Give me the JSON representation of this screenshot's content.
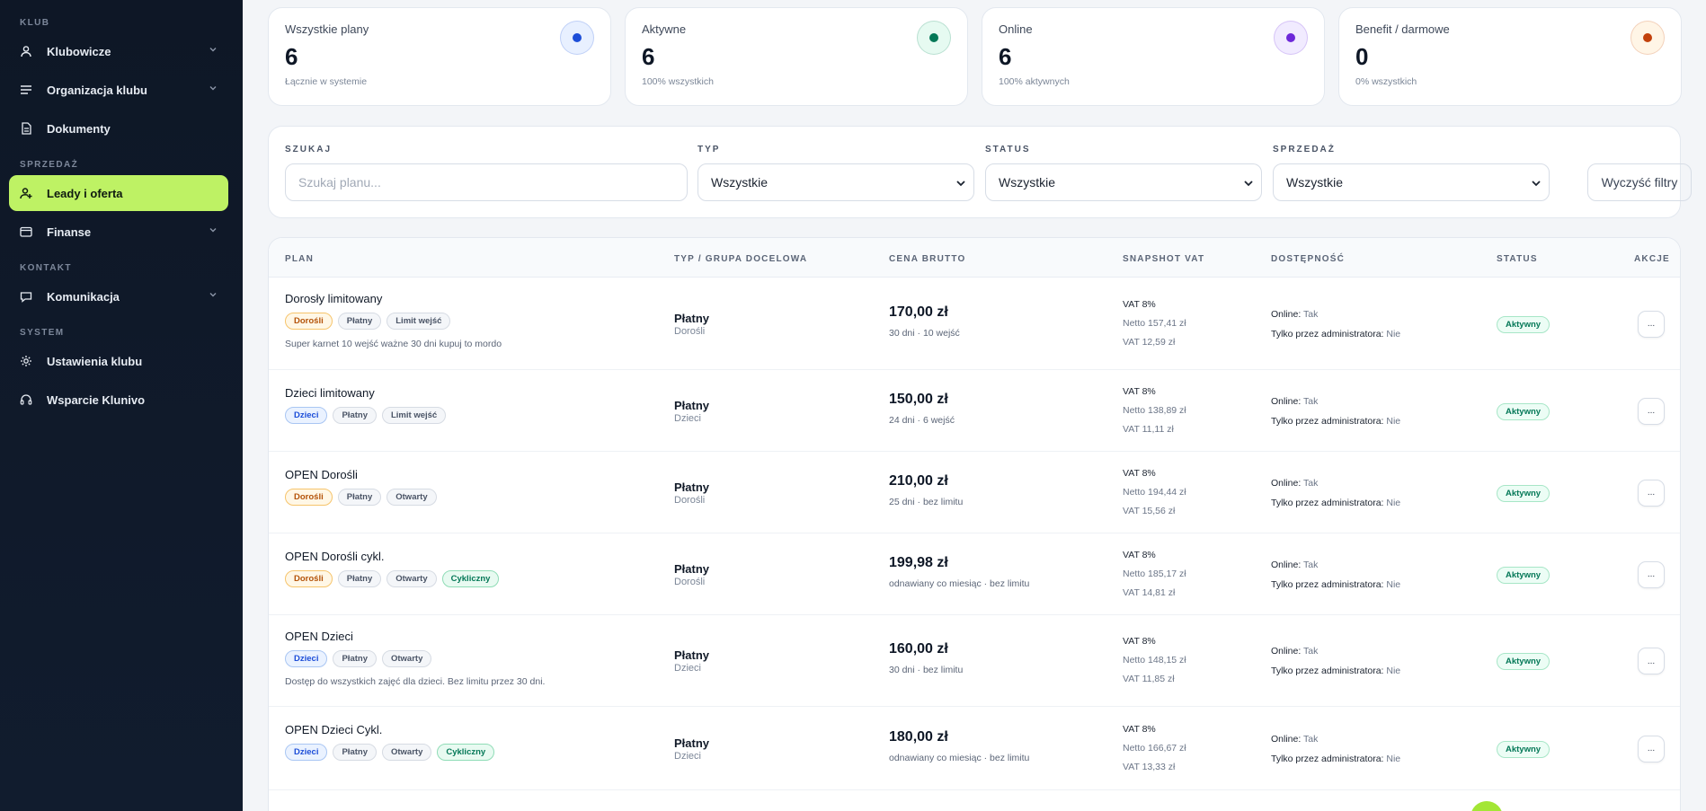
{
  "sidebar": {
    "sections": [
      {
        "label": "KLUB",
        "items": [
          {
            "label": "Klubowicze",
            "icon": "user-icon",
            "chevron": true
          },
          {
            "label": "Organizacja klubu",
            "icon": "list-icon",
            "chevron": true
          },
          {
            "label": "Dokumenty",
            "icon": "document-icon",
            "chevron": false
          }
        ]
      },
      {
        "label": "SPRZEDAŻ",
        "items": [
          {
            "label": "Leady i oferta",
            "icon": "user-plus-icon",
            "chevron": false,
            "active": true
          },
          {
            "label": "Finanse",
            "icon": "wallet-icon",
            "chevron": true
          }
        ]
      },
      {
        "label": "KONTAKT",
        "items": [
          {
            "label": "Komunikacja",
            "icon": "chat-icon",
            "chevron": true
          }
        ]
      },
      {
        "label": "SYSTEM",
        "items": [
          {
            "label": "Ustawienia klubu",
            "icon": "gear-icon",
            "chevron": false
          },
          {
            "label": "Wsparcie Klunivo",
            "icon": "headset-icon",
            "chevron": false
          }
        ]
      }
    ]
  },
  "stats": [
    {
      "title": "Wszystkie plany",
      "value": "6",
      "sub": "Łącznie w systemie",
      "color": "#1d4ed8",
      "ring": "#e8f0ff"
    },
    {
      "title": "Aktywne",
      "value": "6",
      "sub": "100% wszystkich",
      "color": "#047857",
      "ring": "#e6faf1"
    },
    {
      "title": "Online",
      "value": "6",
      "sub": "100% aktywnych",
      "color": "#6d28d9",
      "ring": "#f1ebff"
    },
    {
      "title": "Benefit / darmowe",
      "value": "0",
      "sub": "0% wszystkich",
      "color": "#c2410c",
      "ring": "#fff5e6"
    }
  ],
  "filters": {
    "search_label": "SZUKAJ",
    "search_placeholder": "Szukaj planu...",
    "type_label": "TYP",
    "type_value": "Wszystkie",
    "status_label": "STATUS",
    "status_value": "Wszystkie",
    "sale_label": "SPRZEDAŻ",
    "sale_value": "Wszystkie",
    "clear_label": "Wyczyść filtry"
  },
  "table": {
    "headers": [
      "PLAN",
      "TYP / GRUPA DOCELOWA",
      "CENA BRUTTO",
      "SNAPSHOT VAT",
      "DOSTĘPNOŚĆ",
      "STATUS",
      "AKCJE"
    ],
    "rows": [
      {
        "name": "Dorosły limitowany",
        "tags": [
          [
            "Dorośli",
            "adult"
          ],
          [
            "Płatny",
            ""
          ],
          [
            "Limit wejść",
            ""
          ]
        ],
        "desc": "Super karnet 10 wejść ważne 30 dni kupuj to mordo",
        "type": "Płatny",
        "group": "Dorośli",
        "price": "170,00 zł",
        "price_sub": "30 dni · 10 wejść",
        "vat": "VAT 8%",
        "netto": "Netto 157,41 zł",
        "vat_amt": "VAT 12,59 zł",
        "online_label": "Online:",
        "online_val": "Tak",
        "admin_label": "Tylko przez administratora:",
        "admin_val": "Nie",
        "status": "Aktywny",
        "action": "..."
      },
      {
        "name": "Dzieci limitowany",
        "tags": [
          [
            "Dzieci",
            "kids"
          ],
          [
            "Płatny",
            ""
          ],
          [
            "Limit wejść",
            ""
          ]
        ],
        "desc": "",
        "type": "Płatny",
        "group": "Dzieci",
        "price": "150,00 zł",
        "price_sub": "24 dni · 6 wejść",
        "vat": "VAT 8%",
        "netto": "Netto 138,89 zł",
        "vat_amt": "VAT 11,11 zł",
        "online_label": "Online:",
        "online_val": "Tak",
        "admin_label": "Tylko przez administratora:",
        "admin_val": "Nie",
        "status": "Aktywny",
        "action": "..."
      },
      {
        "name": "OPEN Dorośli",
        "tags": [
          [
            "Dorośli",
            "adult"
          ],
          [
            "Płatny",
            ""
          ],
          [
            "Otwarty",
            ""
          ]
        ],
        "desc": "",
        "type": "Płatny",
        "group": "Dorośli",
        "price": "210,00 zł",
        "price_sub": "25 dni · bez limitu",
        "vat": "VAT 8%",
        "netto": "Netto 194,44 zł",
        "vat_amt": "VAT 15,56 zł",
        "online_label": "Online:",
        "online_val": "Tak",
        "admin_label": "Tylko przez administratora:",
        "admin_val": "Nie",
        "status": "Aktywny",
        "action": "..."
      },
      {
        "name": "OPEN Dorośli cykl.",
        "tags": [
          [
            "Dorośli",
            "adult"
          ],
          [
            "Płatny",
            ""
          ],
          [
            "Otwarty",
            ""
          ],
          [
            "Cykliczny",
            "cyc"
          ]
        ],
        "desc": "",
        "type": "Płatny",
        "group": "Dorośli",
        "price": "199,98 zł",
        "price_sub": "odnawiany co miesiąc · bez limitu",
        "vat": "VAT 8%",
        "netto": "Netto 185,17 zł",
        "vat_amt": "VAT 14,81 zł",
        "online_label": "Online:",
        "online_val": "Tak",
        "admin_label": "Tylko przez administratora:",
        "admin_val": "Nie",
        "status": "Aktywny",
        "action": "..."
      },
      {
        "name": "OPEN Dzieci",
        "tags": [
          [
            "Dzieci",
            "kids"
          ],
          [
            "Płatny",
            ""
          ],
          [
            "Otwarty",
            ""
          ]
        ],
        "desc": "Dostęp do wszystkich zajęć dla dzieci. Bez limitu przez 30 dni.",
        "type": "Płatny",
        "group": "Dzieci",
        "price": "160,00 zł",
        "price_sub": "30 dni · bez limitu",
        "vat": "VAT 8%",
        "netto": "Netto 148,15 zł",
        "vat_amt": "VAT 11,85 zł",
        "online_label": "Online:",
        "online_val": "Tak",
        "admin_label": "Tylko przez administratora:",
        "admin_val": "Nie",
        "status": "Aktywny",
        "action": "..."
      },
      {
        "name": "OPEN Dzieci Cykl.",
        "tags": [
          [
            "Dzieci",
            "kids"
          ],
          [
            "Płatny",
            ""
          ],
          [
            "Otwarty",
            ""
          ],
          [
            "Cykliczny",
            "cyc"
          ]
        ],
        "desc": "",
        "type": "Płatny",
        "group": "Dzieci",
        "price": "180,00 zł",
        "price_sub": "odnawiany co miesiąc · bez limitu",
        "vat": "VAT 8%",
        "netto": "Netto 166,67 zł",
        "vat_amt": "VAT 13,33 zł",
        "online_label": "Online:",
        "online_val": "Tak",
        "admin_label": "Tylko przez administratora:",
        "admin_val": "Nie",
        "status": "Aktywny",
        "action": "..."
      }
    ]
  },
  "colors": {
    "accent": "#bef264",
    "sidebar_bg": "#0e1726"
  }
}
